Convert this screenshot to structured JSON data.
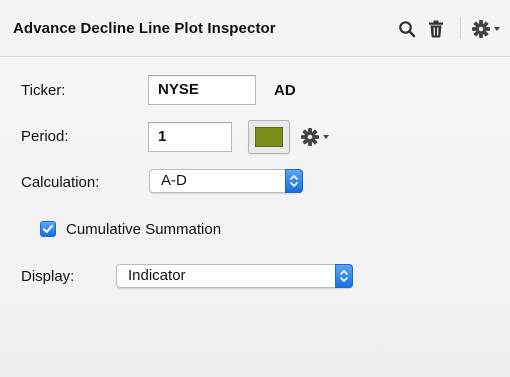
{
  "header": {
    "title": "Advance Decline Line Plot Inspector",
    "icons": [
      "search-icon",
      "trash-icon",
      "gear-menu-icon"
    ]
  },
  "form": {
    "ticker_label": "Ticker:",
    "ticker_value": "NYSE",
    "ticker_suffix": "AD",
    "period_label": "Period:",
    "period_value": "1",
    "line_color": "#7b8f1c",
    "calculation_label": "Calculation:",
    "calculation_value": "A-D",
    "cumulative_label": "Cumulative Summation",
    "cumulative_checked": true,
    "display_label": "Display:",
    "display_value": "Indicator"
  },
  "colors": {
    "accent": "#2f86f0"
  }
}
